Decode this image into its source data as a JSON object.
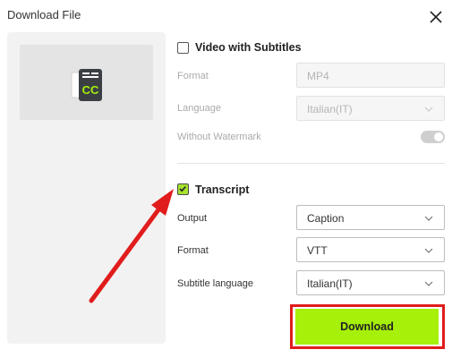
{
  "dialog": {
    "title": "Download File",
    "close_icon": "close-icon"
  },
  "preview": {
    "icon": "cc-subtitle-file-icon",
    "icon_text": "CC"
  },
  "video_section": {
    "title": "Video with Subtitles",
    "checked": false,
    "format_label": "Format",
    "format_value": "MP4",
    "language_label": "Language",
    "language_value": "Italian(IT)",
    "watermark_label": "Without Watermark",
    "watermark_on": true
  },
  "transcript_section": {
    "title": "Transcript",
    "checked": true,
    "output_label": "Output",
    "output_value": "Caption",
    "format_label": "Format",
    "format_value": "VTT",
    "subtitle_language_label": "Subtitle language",
    "subtitle_language_value": "Italian(IT)"
  },
  "download_button": {
    "label": "Download"
  },
  "colors": {
    "accent_green": "#a6f00a",
    "annotation_red": "#e11c1c",
    "checkbox_green": "#a6e22e"
  }
}
